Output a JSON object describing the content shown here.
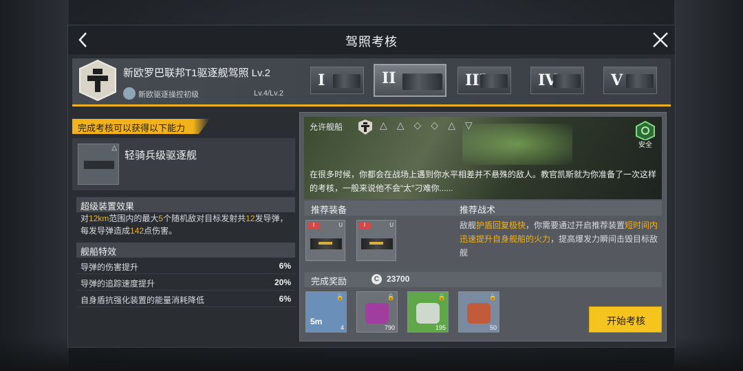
{
  "header": {
    "title": "驾照考核"
  },
  "license": {
    "name": "新欧罗巴联邦T1驱逐舰驾照 Lv.2",
    "sub_name": "新欧驱逐操控初级",
    "level": "Lv.4/Lv.2",
    "tiers": [
      "I",
      "II",
      "III",
      "IV",
      "V"
    ],
    "active_tier": "II"
  },
  "gain": {
    "banner": "完成考核可以获得以下能力",
    "unlock_name": "轻骑兵级驱逐舰"
  },
  "super_device": {
    "heading": "超级装置效果",
    "text_parts": [
      "对",
      "12km",
      "范围内的最大",
      "5",
      "个随机敌对目标发射共",
      "12",
      "发导弹，每发导弹造成",
      "142",
      "点伤害。"
    ]
  },
  "traits": {
    "heading": "舰船特效",
    "items": [
      {
        "name": "导弹的伤害提升",
        "value": "6%"
      },
      {
        "name": "导弹的追踪速度提升",
        "value": "20%"
      },
      {
        "name": "自身盾抗强化装置的能量消耗降低",
        "value": "6%"
      }
    ]
  },
  "scenario": {
    "allowed_label": "允许舰船",
    "safe_label": "安全",
    "story": "在很多时候，你都会在战场上遇到你水平相差并不悬殊的敌人。教官凯斯就为你准备了一次这样的考核，一般来说他不会\"太\"刁难你......"
  },
  "recommend": {
    "equip_label": "推荐装备",
    "tactic_label": "推荐战术",
    "tactic_parts": [
      "敌舰",
      "护盾回复极快",
      "，你需要通过开启推荐装置",
      "短时间内迅速提升自身舰船的火力",
      "，提高爆发力瞬间击毁目标敌舰"
    ]
  },
  "rewards": {
    "label": "完成奖励",
    "coin_value": "23700",
    "items": [
      {
        "kind": "speedup",
        "label": "5m",
        "count": "4",
        "color": "#6a8fb8"
      },
      {
        "kind": "ore-purple",
        "count": "790",
        "color": "#a03d9e"
      },
      {
        "kind": "ore-green",
        "count": "195",
        "color": "#5ea84a"
      },
      {
        "kind": "ore-red",
        "count": "50",
        "color": "#c25a3c"
      }
    ]
  },
  "actions": {
    "start": "开始考核"
  }
}
